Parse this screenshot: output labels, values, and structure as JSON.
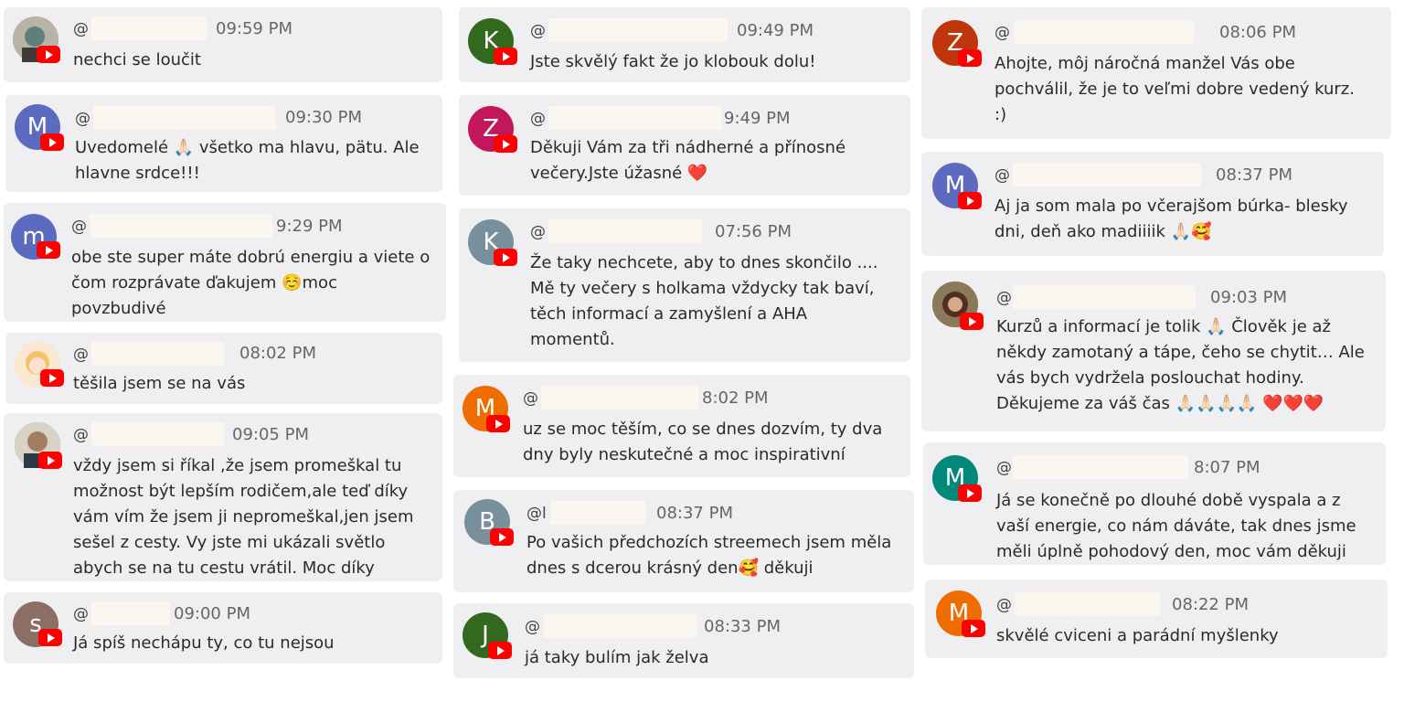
{
  "comments": [
    {
      "id": "c1",
      "at": "@",
      "time": "09:59 PM",
      "avatar": {
        "letter": "",
        "color": "#9a9a8e"
      },
      "text": "nechci se loučit"
    },
    {
      "id": "c2",
      "at": "@",
      "time": "09:30 PM",
      "avatar": {
        "letter": "M",
        "color": "#5c6bc0"
      },
      "text": "Uvedomelé 🙏🏻 všetko ma hlavu, pätu. Ale hlavne srdce!!!"
    },
    {
      "id": "c3",
      "at": "@",
      "time": "9:29 PM",
      "avatar": {
        "letter": "m",
        "color": "#5c6bc0"
      },
      "text": "obe ste super máte dobrú energiu a viete o čom rozprávate ďakujem ☺️moc povzbudivé"
    },
    {
      "id": "c4",
      "at": "@",
      "time": "08:02 PM",
      "avatar": {
        "letter": "",
        "color": "#f4d08a"
      },
      "text": "těšila jsem se na vás"
    },
    {
      "id": "c5",
      "at": "@",
      "time": "09:05 PM",
      "avatar": {
        "letter": "",
        "color": "#7a6a58"
      },
      "text": "vždy jsem si říkal ,že jsem promeškal tu možnost být lepším rodičem,ale teď díky vám vím že jsem ji nepromeškal,jen jsem sešel z cesty. Vy jste mi ukázali světlo abych se na tu cestu vrátil. Moc díky"
    },
    {
      "id": "c6",
      "at": "@",
      "time": "09:00 PM",
      "avatar": {
        "letter": "s",
        "color": "#8d6e63"
      },
      "text": "Já spíš nechápu ty, co tu nejsou"
    },
    {
      "id": "c7",
      "at": "@",
      "time": "09:49 PM",
      "avatar": {
        "letter": "K",
        "color": "#33691e"
      },
      "text": "Jste skvělý fakt že jo klobouk dolu!"
    },
    {
      "id": "c8",
      "at": "@",
      "time": "9:49 PM",
      "avatar": {
        "letter": "Z",
        "color": "#c2185b"
      },
      "text": "Děkuji Vám za tři nádherné a přínosné večery.Jste úžasné ❤️"
    },
    {
      "id": "c9",
      "at": "@",
      "time": "07:56 PM",
      "avatar": {
        "letter": "K",
        "color": "#78909c"
      },
      "text": "Že taky nechcete, aby to dnes skončilo .... Mě ty večery s holkama vždycky tak baví, těch informací a zamyšlení a AHA momentů."
    },
    {
      "id": "c10",
      "at": "@",
      "time": "8:02 PM",
      "avatar": {
        "letter": "M",
        "color": "#ef6c00"
      },
      "text": "uz se moc těším, co se dnes dozvím, ty dva dny byly neskutečné a moc inspirativní"
    },
    {
      "id": "c11",
      "at": "@l",
      "time": "08:37 PM",
      "avatar": {
        "letter": "B",
        "color": "#78909c"
      },
      "text": "Po vašich předchozích streemech jsem měla dnes s dcerou krásný den🥰 děkuji"
    },
    {
      "id": "c12",
      "at": "@",
      "time": "08:33 PM",
      "avatar": {
        "letter": "J",
        "color": "#33691e"
      },
      "text": "já taky bulím jak želva"
    },
    {
      "id": "c13",
      "at": "@",
      "time": "08:06 PM",
      "avatar": {
        "letter": "Z",
        "color": "#bf360c"
      },
      "text": "Ahojte, môj náročná manžel Vás obe pochválil, že je to veľmi dobre vedený kurz. :)"
    },
    {
      "id": "c14",
      "at": "@",
      "time": "08:37 PM",
      "avatar": {
        "letter": "M",
        "color": "#5c6bc0"
      },
      "text": "Aj ja som mala po včerajšom búrka- blesky dni, deň ako madiiiik 🙏🏻🥰"
    },
    {
      "id": "c15",
      "at": "@",
      "time": "09:03 PM",
      "avatar": {
        "letter": "",
        "color": "#6d4c41"
      },
      "text": "Kurzů a informací je tolik 🙏🏻 Člověk je až někdy zamotaný a tápe, čeho se chytit… Ale vás bych vydržela poslouchat hodiny. Děkujeme za váš čas 🙏🏻🙏🏻🙏🏻🙏🏻 ❤️❤️❤️"
    },
    {
      "id": "c16",
      "at": "@",
      "time": "8:07 PM",
      "avatar": {
        "letter": "M",
        "color": "#00897b"
      },
      "text": "Já se konečně po dlouhé době vyspala a z vaší energie, co nám dáváte, tak dnes jsme měli úplně pohodový den, moc vám děkuji"
    },
    {
      "id": "c17",
      "at": "@",
      "time": "08:22 PM",
      "avatar": {
        "letter": "M",
        "color": "#ef6c00"
      },
      "text": "skvělé cviceni a parádní myšlenky"
    }
  ]
}
